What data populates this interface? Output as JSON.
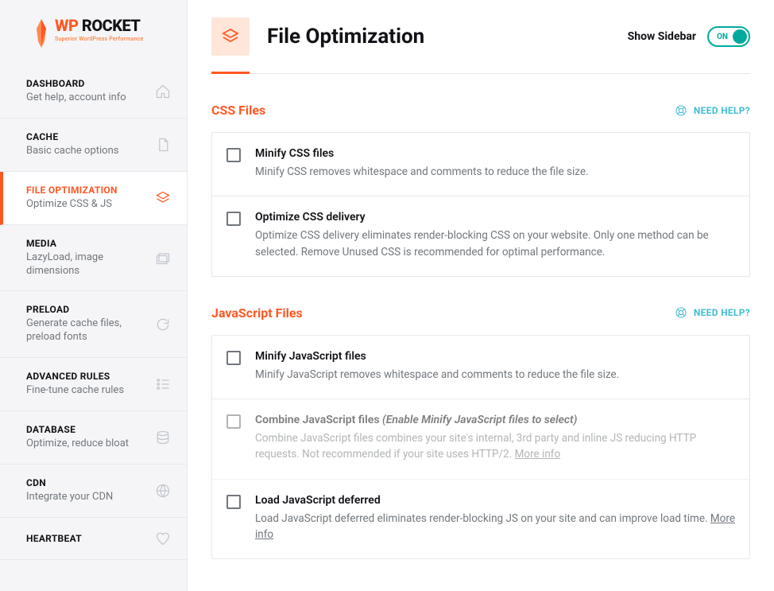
{
  "brand": {
    "name_a": "WP",
    "name_b": "ROCKET",
    "tag": "Superior WordPress Performance"
  },
  "nav": [
    {
      "key": "dashboard",
      "title": "DASHBOARD",
      "desc": "Get help, account info"
    },
    {
      "key": "cache",
      "title": "CACHE",
      "desc": "Basic cache options"
    },
    {
      "key": "file-optimization",
      "title": "FILE OPTIMIZATION",
      "desc": "Optimize CSS & JS"
    },
    {
      "key": "media",
      "title": "MEDIA",
      "desc": "LazyLoad, image dimensions"
    },
    {
      "key": "preload",
      "title": "PRELOAD",
      "desc": "Generate cache files, preload fonts"
    },
    {
      "key": "advanced-rules",
      "title": "ADVANCED RULES",
      "desc": "Fine-tune cache rules"
    },
    {
      "key": "database",
      "title": "DATABASE",
      "desc": "Optimize, reduce bloat"
    },
    {
      "key": "cdn",
      "title": "CDN",
      "desc": "Integrate your CDN"
    },
    {
      "key": "heartbeat",
      "title": "HEARTBEAT",
      "desc": ""
    }
  ],
  "header": {
    "title": "File Optimization",
    "show_sidebar": "Show Sidebar",
    "toggle": "ON"
  },
  "help": "NEED HELP?",
  "sections": {
    "css": {
      "title": "CSS Files",
      "options": [
        {
          "title": "Minify CSS files",
          "desc": "Minify CSS removes whitespace and comments to reduce the file size."
        },
        {
          "title": "Optimize CSS delivery",
          "desc": "Optimize CSS delivery eliminates render-blocking CSS on your website. Only one method can be selected. Remove Unused CSS is recommended for optimal performance."
        }
      ]
    },
    "js": {
      "title": "JavaScript Files",
      "options": [
        {
          "title": "Minify JavaScript files",
          "desc": "Minify JavaScript removes whitespace and comments to reduce the file size."
        },
        {
          "title": "Combine JavaScript files ",
          "hint": "(Enable Minify JavaScript files to select)",
          "desc": "Combine JavaScript files combines your site's internal, 3rd party and inline JS reducing HTTP requests. Not recommended if your site uses HTTP/2. ",
          "more": "More info"
        },
        {
          "title": "Load JavaScript deferred",
          "desc": "Load JavaScript deferred eliminates render-blocking JS on your site and can improve load time. ",
          "more": "More info"
        }
      ]
    }
  }
}
